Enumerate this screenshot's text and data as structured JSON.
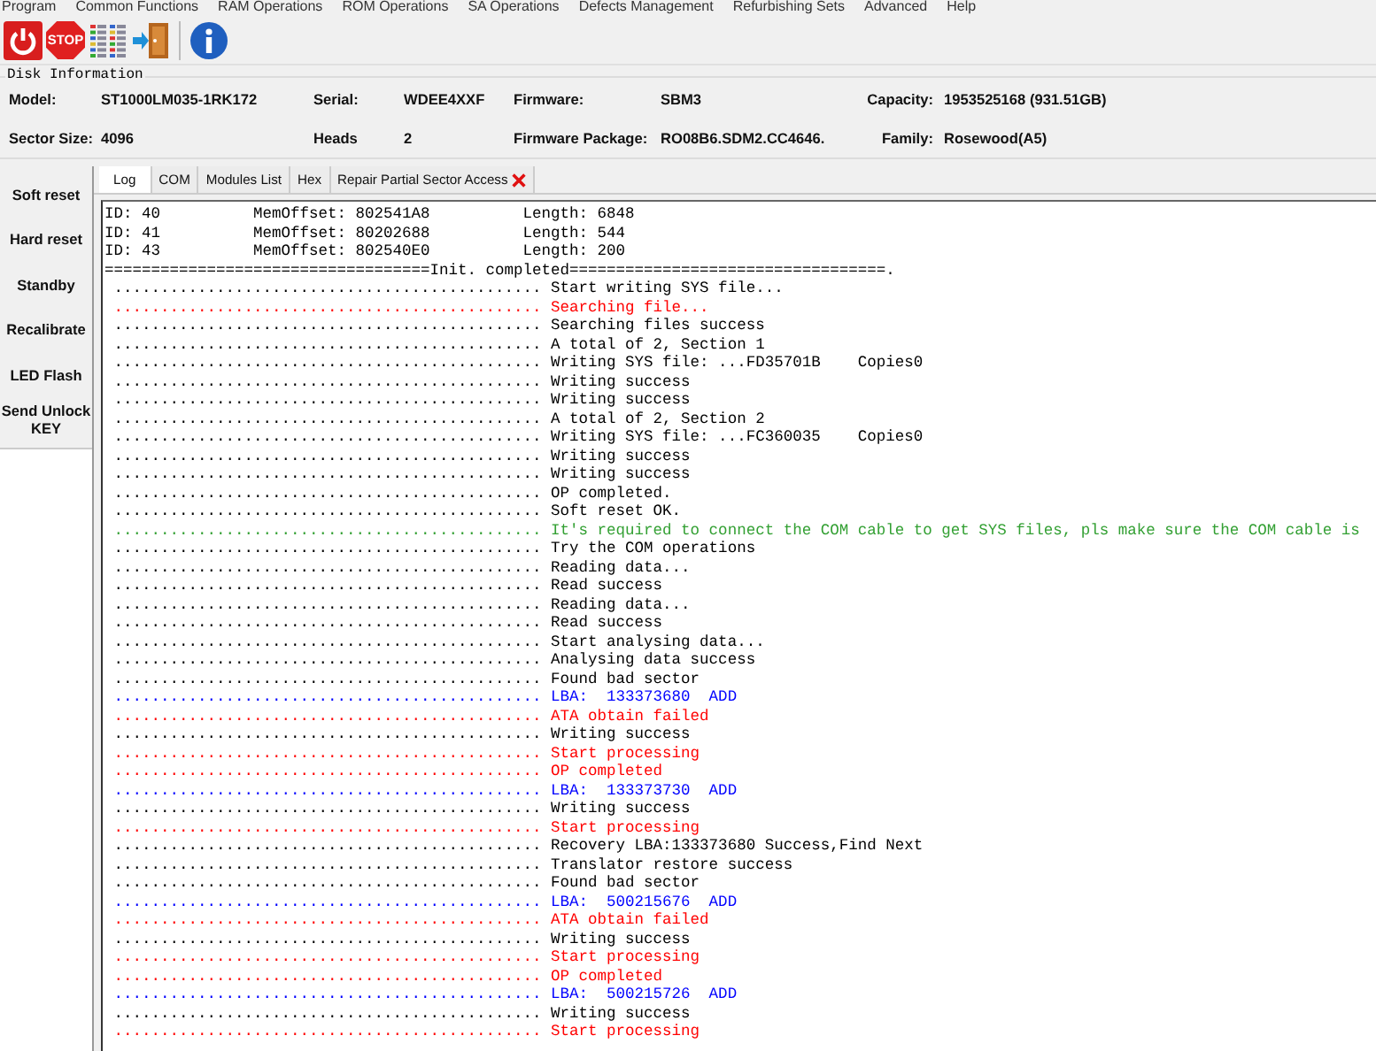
{
  "menu": [
    "Program",
    "Common Functions",
    "RAM Operations",
    "ROM Operations",
    "SA Operations",
    "Defects Management",
    "Refurbishing Sets",
    "Advanced",
    "Help"
  ],
  "toolbar": {
    "stop_label": "STOP"
  },
  "disk_info": {
    "title": "Disk Information",
    "fields": [
      {
        "label": "Model:",
        "value": "ST1000LM035-1RK172"
      },
      {
        "label": "Serial:",
        "value": "WDEE4XXF"
      },
      {
        "label": "Firmware:",
        "value": "SBM3"
      },
      {
        "label": "Capacity:",
        "value": "1953525168 (931.51GB)"
      },
      {
        "label": "Sector Size:",
        "value": "4096"
      },
      {
        "label": "Heads",
        "value": "2"
      },
      {
        "label": "Firmware Package:",
        "value": "RO08B6.SDM2.CC4646."
      },
      {
        "label": "Family:",
        "value": "Rosewood(A5)"
      }
    ]
  },
  "side_buttons": [
    "Soft reset",
    "Hard reset",
    "Standby",
    "Recalibrate",
    "LED Flash",
    "Send Unlock KEY"
  ],
  "tabs": [
    {
      "label": "Log",
      "selected": true,
      "closable": false
    },
    {
      "label": "COM",
      "selected": false,
      "closable": false
    },
    {
      "label": "Modules List",
      "selected": false,
      "closable": false
    },
    {
      "label": "Hex",
      "selected": false,
      "closable": false
    },
    {
      "label": "Repair Partial Sector Access",
      "selected": false,
      "closable": true
    }
  ],
  "log": {
    "header_rows": [
      {
        "id": "ID: 40",
        "offset": "MemOffset: 802541A8",
        "length": "Length: 6848"
      },
      {
        "id": "ID: 41",
        "offset": "MemOffset: 80202688",
        "length": "Length: 544"
      },
      {
        "id": "ID: 43",
        "offset": "MemOffset: 802540E0",
        "length": "Length: 200"
      }
    ],
    "separator": "===================================Init. completed==================================.",
    "lines": [
      {
        "color": "#000000",
        "leader": "..............................................",
        "text": "Start writing SYS file..."
      },
      {
        "color": "#ff0000",
        "leader": "..............................................",
        "text": "Searching file..."
      },
      {
        "color": "#000000",
        "leader": "..............................................",
        "text": "Searching files success"
      },
      {
        "color": "#000000",
        "leader": "..............................................",
        "text": "A total of 2, Section 1"
      },
      {
        "color": "#000000",
        "leader": "..............................................",
        "text": "Writing SYS file: ...FD35701B    Copies0"
      },
      {
        "color": "#000000",
        "leader": "..............................................",
        "text": "Writing success"
      },
      {
        "color": "#000000",
        "leader": "..............................................",
        "text": "Writing success"
      },
      {
        "color": "#000000",
        "leader": "..............................................",
        "text": "A total of 2, Section 2"
      },
      {
        "color": "#000000",
        "leader": "..............................................",
        "text": "Writing SYS file: ...FC360035    Copies0"
      },
      {
        "color": "#000000",
        "leader": "..............................................",
        "text": "Writing success"
      },
      {
        "color": "#000000",
        "leader": "..............................................",
        "text": "Writing success"
      },
      {
        "color": "#000000",
        "leader": "..............................................",
        "text": "OP completed."
      },
      {
        "color": "#000000",
        "leader": "..............................................",
        "text": "Soft reset OK."
      },
      {
        "color": "#33a033",
        "leader": "..............................................",
        "text": "It's required to connect the COM cable to get SYS files, pls make sure the COM cable is"
      },
      {
        "color": "#000000",
        "leader": "..............................................",
        "text": "Try the COM operations"
      },
      {
        "color": "#000000",
        "leader": "..............................................",
        "text": "Reading data..."
      },
      {
        "color": "#000000",
        "leader": "..............................................",
        "text": "Read success"
      },
      {
        "color": "#000000",
        "leader": "..............................................",
        "text": "Reading data..."
      },
      {
        "color": "#000000",
        "leader": "..............................................",
        "text": "Read success"
      },
      {
        "color": "#000000",
        "leader": "..............................................",
        "text": "Start analysing data..."
      },
      {
        "color": "#000000",
        "leader": "..............................................",
        "text": "Analysing data success"
      },
      {
        "color": "#000000",
        "leader": "..............................................",
        "text": "Found bad sector"
      },
      {
        "color": "#0000ff",
        "leader": "..............................................",
        "text": "LBA:  133373680  ADD"
      },
      {
        "color": "#ff0000",
        "leader": "..............................................",
        "text": "ATA obtain failed"
      },
      {
        "color": "#000000",
        "leader": "..............................................",
        "text": "Writing success"
      },
      {
        "color": "#ff0000",
        "leader": "..............................................",
        "text": "Start processing"
      },
      {
        "color": "#ff0000",
        "leader": "..............................................",
        "text": "OP completed"
      },
      {
        "color": "#0000ff",
        "leader": "..............................................",
        "text": "LBA:  133373730  ADD"
      },
      {
        "color": "#000000",
        "leader": "..............................................",
        "text": "Writing success"
      },
      {
        "color": "#ff0000",
        "leader": "..............................................",
        "text": "Start processing"
      },
      {
        "color": "#000000",
        "leader": "..............................................",
        "text": "Recovery LBA:133373680 Success,Find Next"
      },
      {
        "color": "#000000",
        "leader": "..............................................",
        "text": "Translator restore success"
      },
      {
        "color": "#000000",
        "leader": "..............................................",
        "text": "Found bad sector"
      },
      {
        "color": "#0000ff",
        "leader": "..............................................",
        "text": "LBA:  500215676  ADD"
      },
      {
        "color": "#ff0000",
        "leader": "..............................................",
        "text": "ATA obtain failed"
      },
      {
        "color": "#000000",
        "leader": "..............................................",
        "text": "Writing success"
      },
      {
        "color": "#ff0000",
        "leader": "..............................................",
        "text": "Start processing"
      },
      {
        "color": "#ff0000",
        "leader": "..............................................",
        "text": "OP completed"
      },
      {
        "color": "#0000ff",
        "leader": "..............................................",
        "text": "LBA:  500215726  ADD"
      },
      {
        "color": "#000000",
        "leader": "..............................................",
        "text": "Writing success"
      },
      {
        "color": "#ff0000",
        "leader": "..............................................",
        "text": "Start processing"
      }
    ]
  }
}
